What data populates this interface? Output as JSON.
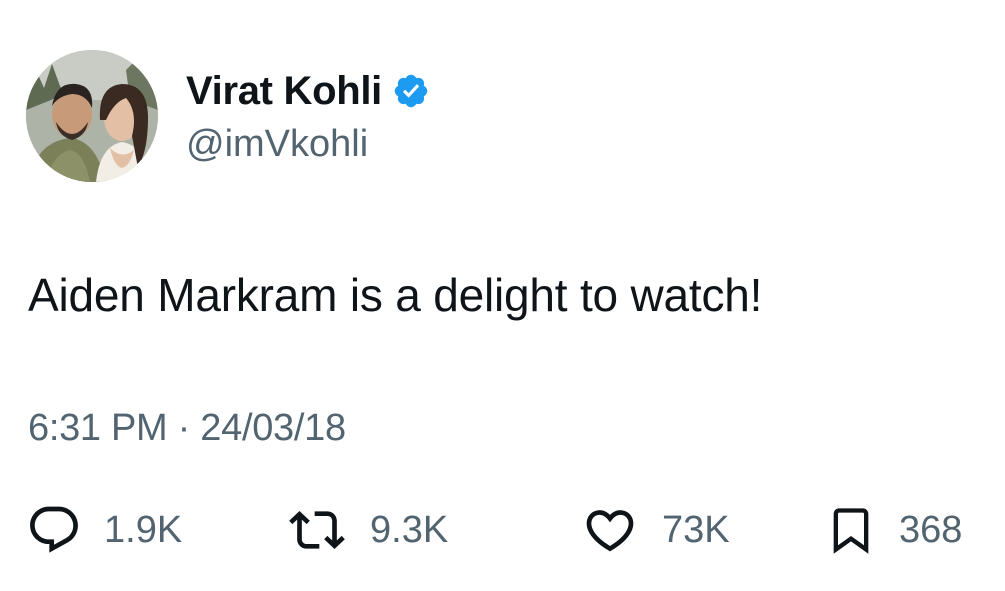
{
  "author": {
    "display_name": "Virat Kohli",
    "handle": "@imVkohli",
    "verified": true,
    "avatar_icon": "profile-photo",
    "verified_icon": "verified-badge-icon"
  },
  "tweet": {
    "text": "Aiden Markram is a delight to watch!",
    "timestamp": "6:31 PM · 24/03/18"
  },
  "actions": [
    {
      "name": "reply",
      "icon": "reply-icon",
      "count": "1.9K"
    },
    {
      "name": "retweet",
      "icon": "retweet-icon",
      "count": "9.3K"
    },
    {
      "name": "like",
      "icon": "heart-icon",
      "count": "73K"
    },
    {
      "name": "bookmark",
      "icon": "bookmark-icon",
      "count": "368"
    }
  ],
  "colors": {
    "text": "#0f1419",
    "secondary_text": "#536471",
    "verified_blue": "#1d9bf0",
    "background": "#ffffff"
  }
}
